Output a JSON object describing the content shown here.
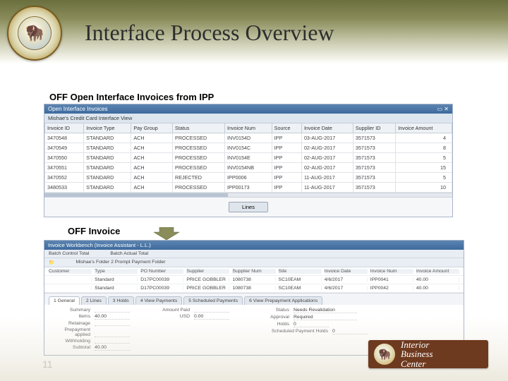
{
  "title": "Interface Process Overview",
  "section_labels": {
    "ipp": "OFF Open Interface Invoices from IPP",
    "invoice": "OFF Invoice"
  },
  "panel1": {
    "window_title": "Open Interface Invoices",
    "list_title": "Mishae's Credit Card Interface View",
    "headers": [
      "Invoice ID",
      "Invoice Type",
      "Pay Group",
      "Status",
      "Invoice Num",
      "Source",
      "Invoice Date",
      "Supplier ID",
      "Invoice Amount"
    ],
    "rows": [
      [
        "3470548",
        "STANDARD",
        "ACH",
        "PROCESSED",
        "INV0154D",
        "IPP",
        "03-AUG-2017",
        "3571573",
        "4"
      ],
      [
        "3470549",
        "STANDARD",
        "ACH",
        "PROCESSED",
        "INV0154C",
        "IPP",
        "02-AUG-2017",
        "3571573",
        "8"
      ],
      [
        "3470550",
        "STANDARD",
        "ACH",
        "PROCESSED",
        "INV0154E",
        "IPP",
        "02-AUG-2017",
        "3571573",
        "5"
      ],
      [
        "3470551",
        "STANDARD",
        "ACH",
        "PROCESSED",
        "INV0154NB",
        "IPP",
        "02-AUG-2017",
        "3571573",
        "15"
      ],
      [
        "3470552",
        "STANDARD",
        "ACH",
        "REJECTED",
        "IPP0006",
        "IPP",
        "11-AUG-2017",
        "3571573",
        "5"
      ],
      [
        "3480533",
        "STANDARD",
        "ACH",
        "PROCESSED",
        "IPP00173",
        "IPP",
        "11-AUG-2017",
        "3571573",
        "10"
      ]
    ],
    "lines_button": "Lines"
  },
  "panel2": {
    "window_title": "Invoice Workbench (Invoice Assistant - L.L.)",
    "batch_control_label": "Batch Control Total",
    "batch_actual_label": "Batch Actual Total",
    "folder_label": "Mishae's Folder 2 Prompt Payment Folder",
    "headers": [
      "Customer",
      "Type",
      "PO Number",
      "Supplier",
      "Supplier Num",
      "Site",
      "Invoice Date",
      "Invoice Num",
      "Invoice Amount"
    ],
    "rows": [
      [
        "",
        "Standard",
        "D17PC00039",
        "PRICE GOBBLER",
        "1080738",
        "SC10EAM",
        "4/6/2017",
        "IPP0041",
        "40.00"
      ],
      [
        "",
        "Standard",
        "D17PC00039",
        "PRICE GOBBLER",
        "1080738",
        "SC10EAM",
        "4/6/2017",
        "IPP0042",
        "40.00"
      ]
    ],
    "tabs": [
      "1 General",
      "2 Lines",
      "3 Holds",
      "4 View Payments",
      "5 Scheduled Payments",
      "6 View Prepayment Applications"
    ],
    "summary": {
      "title": "Summary",
      "amount_paid_label": "Amount Paid",
      "status_label": "Status",
      "status_value": "Needs Revalidation",
      "approval_label": "Approval",
      "approval_value": "Required",
      "holds_label": "Holds",
      "holds_value": "0",
      "items_label": "Items",
      "items_value": "40.00",
      "retainage_label": "Retainage",
      "prepayment_label": "Prepayment applied",
      "withholding_label": "Withholding",
      "subtotal_label": "Subtotal",
      "subtotal_value": "40.00",
      "usd_label": "USD",
      "usd_value": "0.00",
      "sched_hold_label": "Scheduled Payment Holds",
      "sched_hold_value": "0"
    }
  },
  "badge": {
    "line1": "Interior",
    "line2": "Business",
    "line3": "Center"
  },
  "page_number": "11"
}
